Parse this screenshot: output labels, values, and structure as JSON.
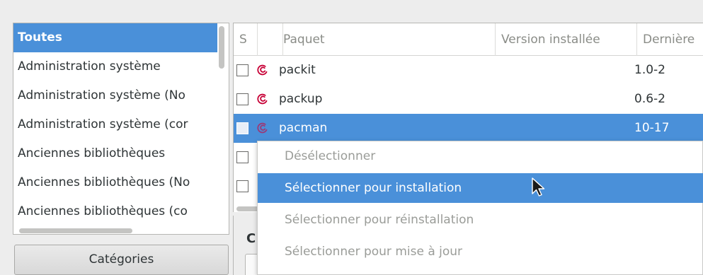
{
  "categories": {
    "items": [
      {
        "label": "Toutes",
        "selected": true
      },
      {
        "label": "Administration système",
        "selected": false
      },
      {
        "label": "Administration système (No",
        "selected": false
      },
      {
        "label": "Administration système (cor",
        "selected": false
      },
      {
        "label": "Anciennes bibliothèques",
        "selected": false
      },
      {
        "label": "Anciennes bibliothèques (No",
        "selected": false
      },
      {
        "label": "Anciennes bibliothèques (co",
        "selected": false
      }
    ],
    "button_label": "Catégories"
  },
  "packages": {
    "columns": {
      "status": "S",
      "package": "Paquet",
      "installed_version": "Version installée",
      "latest_version": "Dernière"
    },
    "rows": [
      {
        "name": "packit",
        "latest": "1.0-2",
        "selected": false
      },
      {
        "name": "packup",
        "latest": "0.6-2",
        "selected": false
      },
      {
        "name": "pacman",
        "latest": "10-17",
        "selected": true
      }
    ]
  },
  "details": {
    "heading_initial": "C"
  },
  "context_menu": {
    "items": [
      {
        "label": "Désélectionner",
        "enabled": false,
        "hover": false
      },
      {
        "label": "Sélectionner pour installation",
        "enabled": true,
        "hover": true
      },
      {
        "label": "Sélectionner pour réinstallation",
        "enabled": false,
        "hover": false
      },
      {
        "label": "Sélectionner pour mise à jour",
        "enabled": false,
        "hover": false
      }
    ]
  },
  "colors": {
    "selection": "#4a90d9",
    "debian_swirl": "#c70036"
  }
}
